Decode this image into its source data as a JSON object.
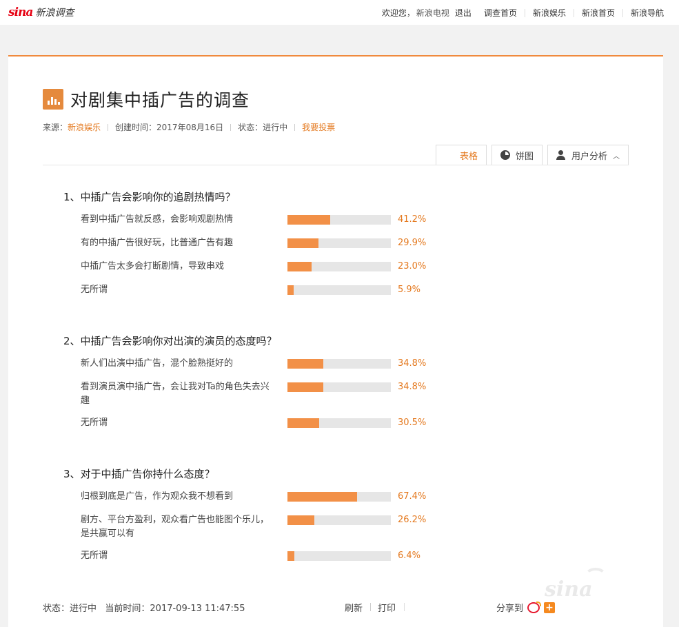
{
  "header": {
    "logo_brand": "sina",
    "logo_text": "新浪调查",
    "welcome": "欢迎您，",
    "username": "新浪电视",
    "logout": "退出",
    "nav": [
      "调查首页",
      "新浪娱乐",
      "新浪首页",
      "新浪导航"
    ]
  },
  "survey": {
    "title": "对剧集中插广告的调查",
    "meta": {
      "source_label": "来源：",
      "source": "新浪娱乐",
      "created": "创建时间：2017年08月16日",
      "status": "状态：进行中",
      "vote": "我要投票"
    },
    "view_tabs": {
      "table": "表格",
      "pie": "饼图",
      "user_analysis": "用户分析"
    },
    "questions": [
      {
        "title": "1、中插广告会影响你的追剧热情吗？",
        "options": [
          {
            "label": "看到中插广告就反感，会影响观剧热情",
            "percent": 41.2,
            "percent_text": "41.2%"
          },
          {
            "label": "有的中插广告很好玩，比普通广告有趣",
            "percent": 29.9,
            "percent_text": "29.9%"
          },
          {
            "label": "中插广告太多会打断剧情，导致串戏",
            "percent": 23.0,
            "percent_text": "23.0%"
          },
          {
            "label": "无所谓",
            "percent": 5.9,
            "percent_text": "5.9%"
          }
        ]
      },
      {
        "title": "2、中插广告会影响你对出演的演员的态度吗？",
        "options": [
          {
            "label": "新人们出演中插广告，混个脸熟挺好的",
            "percent": 34.8,
            "percent_text": "34.8%"
          },
          {
            "label": "看到演员演中插广告，会让我对Ta的角色失去兴趣",
            "percent": 34.8,
            "percent_text": "34.8%"
          },
          {
            "label": "无所谓",
            "percent": 30.5,
            "percent_text": "30.5%"
          }
        ]
      },
      {
        "title": "3、对于中插广告你持什么态度？",
        "options": [
          {
            "label": "归根到底是广告，作为观众我不想看到",
            "percent": 67.4,
            "percent_text": "67.4%"
          },
          {
            "label": "剧方、平台方盈利，观众看广告也能图个乐儿，是共赢可以有",
            "percent": 26.2,
            "percent_text": "26.2%"
          },
          {
            "label": "无所谓",
            "percent": 6.4,
            "percent_text": "6.4%"
          }
        ]
      }
    ]
  },
  "footer": {
    "status": "状态：进行中   当前时间：2017-09-13 11:47:55",
    "refresh": "刷新",
    "print": "打印",
    "share": "分享到"
  },
  "colors": {
    "accent": "#e4791f",
    "bar": "#f29047",
    "bar_track": "#e6e6e6",
    "logo_red": "#e60012"
  }
}
